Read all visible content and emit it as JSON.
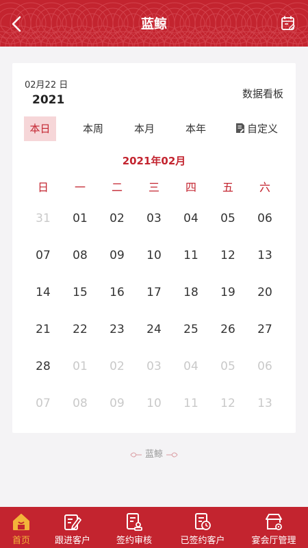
{
  "header": {
    "title": "蓝鲸",
    "back_icon": "chevron-left-icon",
    "calendar_icon": "calendar-edit-icon"
  },
  "card": {
    "date_small": "02月22 日",
    "year": "2021",
    "board_label": "数据看板",
    "tabs": [
      {
        "label": "本日",
        "active": true
      },
      {
        "label": "本周",
        "active": false
      },
      {
        "label": "本月",
        "active": false
      },
      {
        "label": "本年",
        "active": false
      },
      {
        "label": "自定义",
        "active": false,
        "icon": "document-edit-icon"
      }
    ],
    "month_title": "2021年02月",
    "weekdays": [
      "日",
      "一",
      "二",
      "三",
      "四",
      "五",
      "六"
    ],
    "days": [
      {
        "text": "31",
        "muted": true
      },
      {
        "text": "01",
        "muted": false
      },
      {
        "text": "02",
        "muted": false
      },
      {
        "text": "03",
        "muted": false
      },
      {
        "text": "04",
        "muted": false
      },
      {
        "text": "05",
        "muted": false
      },
      {
        "text": "06",
        "muted": false
      },
      {
        "text": "07",
        "muted": false
      },
      {
        "text": "08",
        "muted": false
      },
      {
        "text": "09",
        "muted": false
      },
      {
        "text": "10",
        "muted": false
      },
      {
        "text": "11",
        "muted": false
      },
      {
        "text": "12",
        "muted": false
      },
      {
        "text": "13",
        "muted": false
      },
      {
        "text": "14",
        "muted": false
      },
      {
        "text": "15",
        "muted": false
      },
      {
        "text": "16",
        "muted": false
      },
      {
        "text": "17",
        "muted": false
      },
      {
        "text": "18",
        "muted": false
      },
      {
        "text": "19",
        "muted": false
      },
      {
        "text": "20",
        "muted": false
      },
      {
        "text": "21",
        "muted": false
      },
      {
        "text": "22",
        "muted": false
      },
      {
        "text": "23",
        "muted": false
      },
      {
        "text": "24",
        "muted": false
      },
      {
        "text": "25",
        "muted": false
      },
      {
        "text": "26",
        "muted": false
      },
      {
        "text": "27",
        "muted": false
      },
      {
        "text": "28",
        "muted": false
      },
      {
        "text": "01",
        "muted": true
      },
      {
        "text": "02",
        "muted": true
      },
      {
        "text": "03",
        "muted": true
      },
      {
        "text": "04",
        "muted": true
      },
      {
        "text": "05",
        "muted": true
      },
      {
        "text": "06",
        "muted": true
      },
      {
        "text": "07",
        "muted": true
      },
      {
        "text": "08",
        "muted": true
      },
      {
        "text": "09",
        "muted": true
      },
      {
        "text": "10",
        "muted": true
      },
      {
        "text": "11",
        "muted": true
      },
      {
        "text": "12",
        "muted": true
      },
      {
        "text": "13",
        "muted": true
      }
    ]
  },
  "footer": {
    "brand": "蓝鲸"
  },
  "tabbar": {
    "items": [
      {
        "label": "首页",
        "icon": "home-icon",
        "active": true
      },
      {
        "label": "跟进客户",
        "icon": "edit-note-icon",
        "active": false
      },
      {
        "label": "签约审核",
        "icon": "document-stamp-icon",
        "active": false
      },
      {
        "label": "已签约客户",
        "icon": "document-clock-icon",
        "active": false
      },
      {
        "label": "宴会厅管理",
        "icon": "venue-settings-icon",
        "active": false
      }
    ]
  },
  "colors": {
    "brand_red": "#c3242f",
    "active_tab_bg": "#f6d6d8",
    "tabbar_active": "#f3b43a",
    "muted_day": "#c9c9c9",
    "background": "#f4f3f5"
  }
}
